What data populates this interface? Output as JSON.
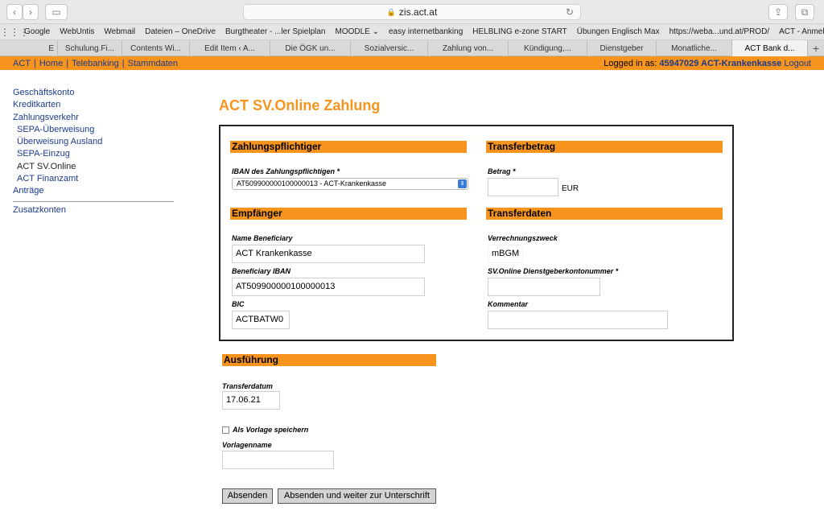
{
  "browser": {
    "url": "zis.act.at",
    "bookmarks": [
      "Google",
      "WebUntis",
      "Webmail",
      "Dateien – OneDrive",
      "Burgtheater - ...ler Spielplan",
      "MOODLE ⌄",
      "easy internetbanking",
      "HELBLING e-zone START",
      "Übungen Englisch Max",
      "https://weba...und.at/PROD/",
      "ACT - Anmelden",
      ">>"
    ],
    "tabs": [
      "E",
      "Schulung.Fi...",
      "Contents Wi...",
      "Edit Item ‹ A...",
      "Die ÖGK un...",
      "Sozialversic...",
      "Zahlung von...",
      "Kündigung,...",
      "Dienstgeber",
      "Monatliche...",
      "ACT Bank d..."
    ]
  },
  "nav": {
    "links": [
      "ACT",
      "Home",
      "Telebanking",
      "Stammdaten"
    ],
    "logged_in_label": "Logged in as:",
    "logged_in_user": "45947029 ACT-Krankenkasse",
    "logout": "Logout"
  },
  "sidebar": {
    "items": [
      {
        "label": "Geschäftskonto"
      },
      {
        "label": "Kreditkarten"
      },
      {
        "label": "Zahlungsverkehr"
      },
      {
        "label": "SEPA-Überweisung"
      },
      {
        "label": "Überweisung Ausland"
      },
      {
        "label": "SEPA-Einzug"
      },
      {
        "label": "ACT SV.Online"
      },
      {
        "label": "ACT Finanzamt"
      },
      {
        "label": "Anträge"
      },
      {
        "label": "Zusatzkonten"
      }
    ]
  },
  "main": {
    "title": "ACT SV.Online Zahlung",
    "zahlungspflichtiger": {
      "heading": "Zahlungspflichtiger",
      "iban_label": "IBAN des Zahlungspflichtigen *",
      "iban_value": "AT509900000100000013 - ACT-Krankenkasse"
    },
    "empfaenger": {
      "heading": "Empfänger",
      "name_label": "Name Beneficiary",
      "name_value": "ACT Krankenkasse",
      "iban_label": "Beneficiary IBAN",
      "iban_value": "AT509900000100000013",
      "bic_label": "BIC",
      "bic_value": "ACTBATW0"
    },
    "transferbetrag": {
      "heading": "Transferbetrag",
      "betrag_label": "Betrag *",
      "betrag_value": "",
      "currency": "EUR"
    },
    "transferdaten": {
      "heading": "Transferdaten",
      "zweck_label": "Verrechnungszweck",
      "zweck_value": "mBGM",
      "dg_label": "SV.Online Dienstgeberkontonummer *",
      "dg_value": "",
      "kommentar_label": "Kommentar",
      "kommentar_value": ""
    },
    "ausfuehrung": {
      "heading": "Ausführung",
      "datum_label": "Transferdatum",
      "datum_value": "17.06.21",
      "vorlage_label": "Als Vorlage speichern",
      "vorlagenname_label": "Vorlagenname",
      "vorlagenname_value": ""
    },
    "buttons": {
      "submit": "Absenden",
      "submit_sign": "Absenden und weiter zur Unterschrift"
    }
  }
}
